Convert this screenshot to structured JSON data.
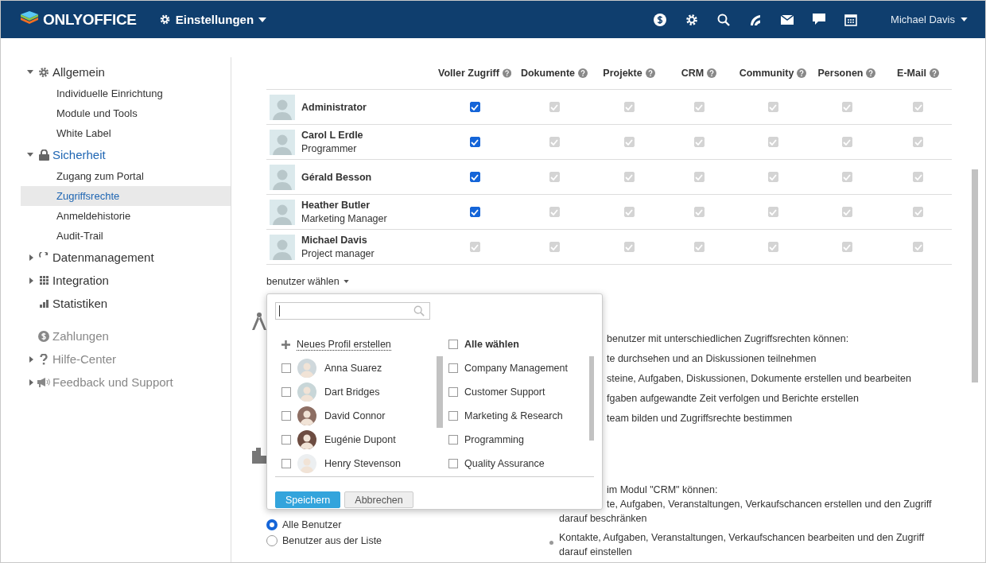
{
  "header": {
    "logo": "ONLYOFFICE",
    "module": "Einstellungen",
    "user": "Michael Davis"
  },
  "sidebar": {
    "groups": [
      {
        "muted": false,
        "items": [
          {
            "label": "Allgemein",
            "expanded": true,
            "selected": false,
            "children": [
              {
                "label": "Individuelle Einrichtung",
                "selected": false
              },
              {
                "label": "Module und Tools",
                "selected": false
              },
              {
                "label": "White Label",
                "selected": false
              }
            ]
          },
          {
            "label": "Sicherheit",
            "expanded": true,
            "selected": true,
            "children": [
              {
                "label": "Zugang zum Portal",
                "selected": false
              },
              {
                "label": "Zugriffsrechte",
                "selected": true
              },
              {
                "label": "Anmeldehistorie",
                "selected": false
              },
              {
                "label": "Audit-Trail",
                "selected": false
              }
            ]
          },
          {
            "label": "Datenmanagement",
            "expanded": false,
            "selected": false
          },
          {
            "label": "Integration",
            "expanded": false,
            "selected": false
          },
          {
            "label": "Statistiken",
            "selected": false
          }
        ]
      },
      {
        "muted": true,
        "items": [
          {
            "label": "Zahlungen",
            "selected": false
          },
          {
            "label": "Hilfe-Center",
            "expanded": false,
            "selected": false
          },
          {
            "label": "Feedback und Support",
            "expanded": false,
            "selected": false
          }
        ]
      }
    ]
  },
  "table": {
    "columns": [
      "Voller Zugriff",
      "Dokumente",
      "Projekte",
      "CRM",
      "Community",
      "Personen",
      "E-Mail"
    ],
    "rows": [
      {
        "name": "Administrator",
        "rights": [
          {
            "checked": true,
            "disabled": false
          },
          {
            "checked": true,
            "disabled": true
          },
          {
            "checked": true,
            "disabled": true
          },
          {
            "checked": true,
            "disabled": true
          },
          {
            "checked": true,
            "disabled": true
          },
          {
            "checked": true,
            "disabled": true
          },
          {
            "checked": true,
            "disabled": true
          }
        ]
      },
      {
        "name": "Carol L Erdle",
        "title": "Programmer",
        "rights": [
          {
            "checked": true,
            "disabled": false
          },
          {
            "checked": true,
            "disabled": true
          },
          {
            "checked": true,
            "disabled": true
          },
          {
            "checked": true,
            "disabled": true
          },
          {
            "checked": true,
            "disabled": true
          },
          {
            "checked": true,
            "disabled": true
          },
          {
            "checked": true,
            "disabled": true
          }
        ]
      },
      {
        "name": "Gérald Besson",
        "rights": [
          {
            "checked": true,
            "disabled": false
          },
          {
            "checked": true,
            "disabled": true
          },
          {
            "checked": true,
            "disabled": true
          },
          {
            "checked": true,
            "disabled": true
          },
          {
            "checked": true,
            "disabled": true
          },
          {
            "checked": true,
            "disabled": true
          },
          {
            "checked": true,
            "disabled": true
          }
        ]
      },
      {
        "name": "Heather Butler",
        "title": "Marketing Manager",
        "rights": [
          {
            "checked": true,
            "disabled": false
          },
          {
            "checked": true,
            "disabled": true
          },
          {
            "checked": true,
            "disabled": true
          },
          {
            "checked": true,
            "disabled": true
          },
          {
            "checked": true,
            "disabled": true
          },
          {
            "checked": true,
            "disabled": true
          },
          {
            "checked": true,
            "disabled": true
          }
        ]
      },
      {
        "name": "Michael Davis",
        "title": "Project manager",
        "rights": [
          {
            "checked": true,
            "disabled": true
          },
          {
            "checked": true,
            "disabled": true
          },
          {
            "checked": true,
            "disabled": true
          },
          {
            "checked": true,
            "disabled": true
          },
          {
            "checked": true,
            "disabled": true
          },
          {
            "checked": true,
            "disabled": true
          },
          {
            "checked": true,
            "disabled": true
          }
        ]
      }
    ]
  },
  "user_selector": {
    "label": "benutzer wählen"
  },
  "popup": {
    "create_link": "Neues Profil erstellen",
    "users": [
      {
        "name": "Anna Suarez",
        "checked": false
      },
      {
        "name": "Dart Bridges",
        "checked": false
      },
      {
        "name": "David Connor",
        "checked": false
      },
      {
        "name": "Eugénie Dupont",
        "checked": false
      },
      {
        "name": "Henry Stevenson",
        "checked": false
      }
    ],
    "select_all": {
      "label": "Alle wählen",
      "checked": false
    },
    "groups": [
      {
        "name": "Company Management",
        "checked": false
      },
      {
        "name": "Customer Support",
        "checked": false
      },
      {
        "name": "Marketing & Research",
        "checked": false
      },
      {
        "name": "Programming",
        "checked": false
      },
      {
        "name": "Quality Assurance",
        "checked": false
      }
    ],
    "buttons": [
      "Speichern",
      "Abbrechen"
    ]
  },
  "projects_section": {
    "intro": "benutzer mit unterschiedlichen Zugriffsrechten können:",
    "lines": [
      "te durchsehen und an Diskussionen teilnehmen",
      "steine, Aufgaben, Diskussionen, Dokumente erstellen und bearbeiten",
      "fgaben aufgewandte Zeit verfolgen und Berichte erstellen",
      "team bilden und Zugriffsrechte bestimmen"
    ]
  },
  "crm_section": {
    "intro": "im Modul \"CRM\" können:",
    "partial_line": "te, Aufgaben, Veranstaltungen, Verkaufschancen erstellen und den Zugriff",
    "partial_line_end": "darauf beschränken",
    "bullets": [
      "Kontakte, Aufgaben, Veranstaltungen, Verkaufschancen bearbeiten und den Zugriff darauf einstellen"
    ],
    "radios": [
      {
        "label": "Alle Benutzer",
        "selected": true
      },
      {
        "label": "Benutzer aus der Liste",
        "selected": false
      }
    ]
  }
}
